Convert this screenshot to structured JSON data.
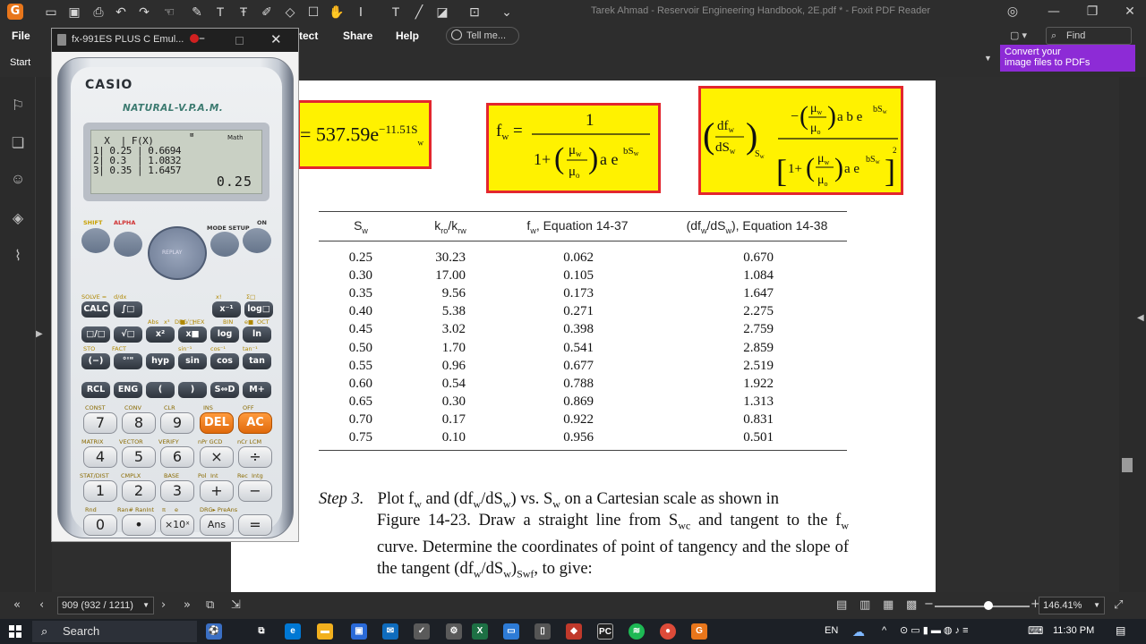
{
  "window": {
    "title": "Tarek Ahmad - Reservoir Engineering Handbook, 2E.pdf * - Foxit PDF Reader",
    "app_logo_letter": "G"
  },
  "menu": {
    "file": "File",
    "protect_partial": "tect",
    "share": "Share",
    "help": "Help",
    "tell_me": "Tell me...",
    "find": "Find"
  },
  "ribbon": {
    "start_tab": "Start",
    "convert_banner_line1": "Convert your",
    "convert_banner_line2": "image files to PDFs"
  },
  "calculator": {
    "window_title": "fx-991ES PLUS C Emul...",
    "brand": "CASIO",
    "series": "NATURAL-V.P.A.M.",
    "lcd": {
      "mode_indicator": "Math",
      "table_header": "  X  | F(X)",
      "rows": [
        "1| 0.25 | 0.6694",
        "2| 0.3  | 1.0832",
        "3| 0.35 | 1.6457"
      ],
      "result": "0.25"
    },
    "keys": {
      "shift": "SHIFT",
      "alpha": "ALPHA",
      "mode": "MODE SETUP",
      "on": "ON",
      "replay": "REPLAY",
      "calc": "CALC",
      "integral": "∫□",
      "xinv": "x⁻¹",
      "logb": "log□",
      "frac": "□/□",
      "sqrt": "√□",
      "sq": "x²",
      "pow": "x■",
      "log": "log",
      "ln": "ln",
      "neg": "(−)",
      "deg": "°'\"",
      "hyp": "hyp",
      "sin": "sin",
      "cos": "cos",
      "tan": "tan",
      "rcl": "RCL",
      "eng": "ENG",
      "lpar": "(",
      "rpar": ")",
      "sd": "S⇔D",
      "mplus": "M+",
      "n7": "7",
      "n8": "8",
      "n9": "9",
      "del": "DEL",
      "ac": "AC",
      "n4": "4",
      "n5": "5",
      "n6": "6",
      "mul": "×",
      "div": "÷",
      "n1": "1",
      "n2": "2",
      "n3": "3",
      "plus": "+",
      "minus": "−",
      "n0": "0",
      "dot": "•",
      "exp": "×10ˣ",
      "ans": "Ans",
      "eq": "="
    },
    "labels": {
      "solve": "SOLVE =",
      "dx": "d/dx",
      "xfact": "x!",
      "sum": "Σ□",
      "rnd": "Rnd",
      "ranhash": "Ran# RanInt",
      "pi": "π",
      "e": "e",
      "drg": "DRG▸ PreAns",
      "abs": "Abs",
      "cube": "x³",
      "dec": "DEC",
      "root": "■√□",
      "hex": "HEX",
      "ten": "10■",
      "bin": "BIN",
      "epow": "e■",
      "oct": "OCT",
      "const": "CONST",
      "conv": "CONV",
      "clr": "CLR",
      "ins": "INS",
      "off": "OFF",
      "matrix": "MATRIX",
      "vector": "VECTOR",
      "verify": "VERIFY",
      "npr": "nPr GCD",
      "ncr": "nCr LCM",
      "statdist": "STAT/DIST",
      "cmplx": "CMPLX",
      "base": "BASE",
      "pol": "Pol",
      "int": "Int",
      "rec": "Rec",
      "intg": "Intg",
      "sto": "STO",
      "fact": "FACT",
      "sin1": "sin⁻¹",
      "cos1": "cos⁻¹",
      "tan1": "tan⁻¹"
    }
  },
  "document": {
    "eq1_partial": "= 537.59e",
    "eq1_exp": "−11.51S",
    "eq1_sub": "w",
    "table": {
      "headers": [
        "S_w",
        "k_ro/k_rw",
        "f_w, Equation 14-37",
        "(df_w/dS_w), Equation 14-38"
      ],
      "rows": [
        [
          "0.25",
          "30.23",
          "0.062",
          "0.670"
        ],
        [
          "0.30",
          "17.00",
          "0.105",
          "1.084"
        ],
        [
          "0.35",
          "9.56",
          "0.173",
          "1.647"
        ],
        [
          "0.40",
          "5.38",
          "0.271",
          "2.275"
        ],
        [
          "0.45",
          "3.02",
          "0.398",
          "2.759"
        ],
        [
          "0.50",
          "1.70",
          "0.541",
          "2.859"
        ],
        [
          "0.55",
          "0.96",
          "0.677",
          "2.519"
        ],
        [
          "0.60",
          "0.54",
          "0.788",
          "1.922"
        ],
        [
          "0.65",
          "0.30",
          "0.869",
          "1.313"
        ],
        [
          "0.70",
          "0.17",
          "0.922",
          "0.831"
        ],
        [
          "0.75",
          "0.10",
          "0.956",
          "0.501"
        ]
      ]
    },
    "step_label": "Step 3.",
    "step_text": "Plot fw and (dfw/dSw) vs. Sw on a Cartesian scale as shown in Figure 14-23. Draw a straight line from Swc and tangent to the fw curve. Determine the coordinates of point of tangency and the slope of the tangent (dfw/dSw)Swf, to give:"
  },
  "status": {
    "page_indicator": "909 (932 / 1211)",
    "zoom": "146.41%"
  },
  "taskbar": {
    "search": "Search",
    "language": "EN",
    "time": "11:30 PM"
  }
}
